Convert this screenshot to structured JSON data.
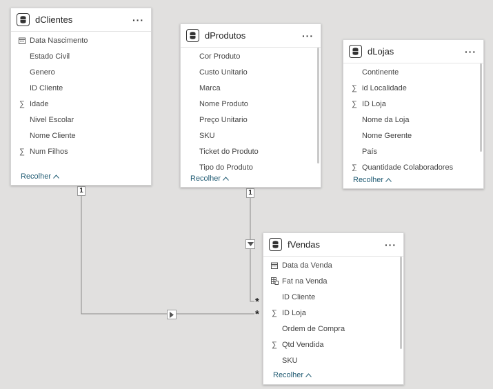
{
  "tables": {
    "dClientes": {
      "title": "dClientes",
      "more": "···",
      "fields": [
        {
          "icon": "calendar-icon",
          "label": "Data Nascimento"
        },
        {
          "icon": "",
          "label": "Estado Civil"
        },
        {
          "icon": "",
          "label": "Genero"
        },
        {
          "icon": "",
          "label": "ID Cliente"
        },
        {
          "icon": "sum-icon",
          "label": "Idade"
        },
        {
          "icon": "",
          "label": "Nivel Escolar"
        },
        {
          "icon": "",
          "label": "Nome Cliente"
        },
        {
          "icon": "sum-icon",
          "label": "Num Filhos"
        }
      ],
      "collapse": "Recolher"
    },
    "dProdutos": {
      "title": "dProdutos",
      "more": "···",
      "fields": [
        {
          "icon": "",
          "label": "Cor Produto"
        },
        {
          "icon": "",
          "label": "Custo Unitario"
        },
        {
          "icon": "",
          "label": "Marca"
        },
        {
          "icon": "",
          "label": "Nome Produto"
        },
        {
          "icon": "",
          "label": "Preço Unitario"
        },
        {
          "icon": "",
          "label": "SKU"
        },
        {
          "icon": "",
          "label": "Ticket do Produto"
        },
        {
          "icon": "",
          "label": "Tipo do Produto"
        }
      ],
      "collapse": "Recolher"
    },
    "dLojas": {
      "title": "dLojas",
      "more": "···",
      "fields": [
        {
          "icon": "",
          "label": "Continente"
        },
        {
          "icon": "sum-icon",
          "label": "id Localidade"
        },
        {
          "icon": "sum-icon",
          "label": "ID Loja"
        },
        {
          "icon": "",
          "label": "Nome da Loja"
        },
        {
          "icon": "",
          "label": "Nome Gerente"
        },
        {
          "icon": "",
          "label": "País"
        },
        {
          "icon": "sum-icon",
          "label": "Quantidade Colaboradores"
        }
      ],
      "collapse": "Recolher"
    },
    "fVendas": {
      "title": "fVendas",
      "more": "···",
      "fields": [
        {
          "icon": "calendar-icon",
          "label": "Data da Venda"
        },
        {
          "icon": "calculated-icon",
          "label": "Fat na Venda"
        },
        {
          "icon": "",
          "label": "ID Cliente"
        },
        {
          "icon": "sum-icon",
          "label": "ID Loja"
        },
        {
          "icon": "",
          "label": "Ordem de Compra"
        },
        {
          "icon": "sum-icon",
          "label": "Qtd Vendida"
        },
        {
          "icon": "",
          "label": "SKU"
        }
      ],
      "collapse": "Recolher"
    }
  },
  "relationships": {
    "one_label": "1",
    "many_label": "*"
  }
}
